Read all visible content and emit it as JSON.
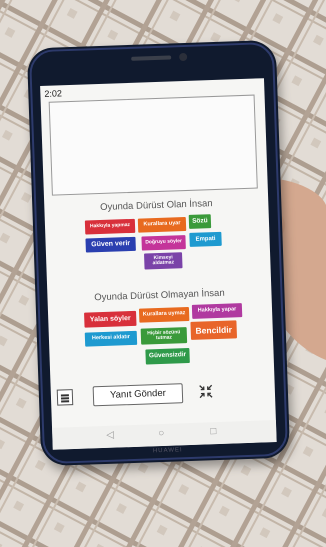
{
  "status_bar": {
    "time": "2:02"
  },
  "sections": {
    "honest_title": "Oyunda Dürüst Olan İnsan",
    "dishonest_title": "Oyunda Dürüst Olmayan İnsan"
  },
  "honest_tags": [
    {
      "label": "Hakkıyla yapmaz",
      "color": "#d8303b"
    },
    {
      "label": "Kurallara uyar",
      "color": "#e86a1f"
    },
    {
      "label": "Sözü",
      "color": "#3a9a3a"
    },
    {
      "label": "Güven verir",
      "color": "#2a3fb0"
    },
    {
      "label": "Doğruyu söyler",
      "color": "#c4349a"
    },
    {
      "label": "Empati",
      "color": "#1e9ad0"
    },
    {
      "label": "Kimseyi aldatmaz",
      "color": "#7a43a8"
    }
  ],
  "dishonest_tags": [
    {
      "label": "Yalan söyler",
      "color": "#d8303b"
    },
    {
      "label": "Kurallara uymaz",
      "color": "#e86a1f"
    },
    {
      "label": "Hakkıyla yapar",
      "color": "#b03aa0"
    },
    {
      "label": "Herkesi aldatır",
      "color": "#1e9ad0"
    },
    {
      "label": "Hiçbir sözünü tutmaz",
      "color": "#3a9a3a"
    },
    {
      "label": "Bencildir",
      "color": "#e8652a"
    },
    {
      "label": "Güvensizdir",
      "color": "#2f9a4a"
    }
  ],
  "actions": {
    "send_label": "Yanıt Gönder",
    "menu_icon": "hamburger-menu-icon",
    "collapse_icon": "collapse-arrows-icon"
  },
  "navigation": {
    "back": "◁",
    "home": "○",
    "recents": "□"
  },
  "device": {
    "brand": "HUAWEI"
  }
}
